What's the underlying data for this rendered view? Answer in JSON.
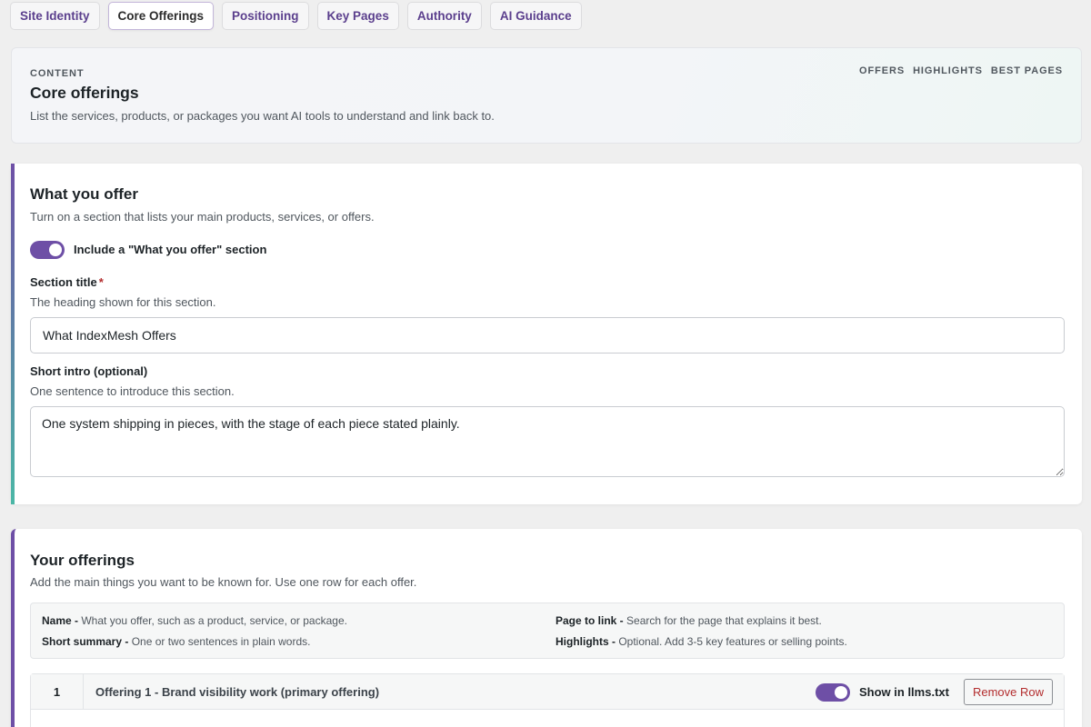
{
  "tabs": [
    {
      "label": "Site Identity",
      "active": false
    },
    {
      "label": "Core Offerings",
      "active": true
    },
    {
      "label": "Positioning",
      "active": false
    },
    {
      "label": "Key Pages",
      "active": false
    },
    {
      "label": "Authority",
      "active": false
    },
    {
      "label": "AI Guidance",
      "active": false
    }
  ],
  "header": {
    "eyebrow": "CONTENT",
    "title": "Core offerings",
    "description": "List the services, products, or packages you want AI tools to understand and link back to.",
    "quick_links": [
      "OFFERS",
      "HIGHLIGHTS",
      "BEST PAGES"
    ]
  },
  "what_you_offer": {
    "title": "What you offer",
    "description": "Turn on a section that lists your main products, services, or offers.",
    "toggle": {
      "label": "Include a \"What you offer\" section",
      "on": true
    },
    "section_title": {
      "label": "Section title",
      "required_mark": "*",
      "help": "The heading shown for this section.",
      "value": "What IndexMesh Offers"
    },
    "short_intro": {
      "label": "Short intro (optional)",
      "help": "One sentence to introduce this section.",
      "value": "One system shipping in pieces, with the stage of each piece stated plainly."
    }
  },
  "your_offerings": {
    "title": "Your offerings",
    "description": "Add the main things you want to be known for. Use one row for each offer.",
    "legend": [
      {
        "term": "Name -",
        "text": "What you offer, such as a product, service, or package."
      },
      {
        "term": "Short summary -",
        "text": "One or two sentences in plain words."
      },
      {
        "term": "Page to link -",
        "text": "Search for the page that explains it best."
      },
      {
        "term": "Highlights -",
        "text": "Optional. Add 3-5 key features or selling points."
      }
    ],
    "rows": [
      {
        "number": "1",
        "title": "Offering 1 - Brand visibility work (primary offering)",
        "show_toggle_label": "Show in llms.txt",
        "show_on": true,
        "remove_label": "Remove Row"
      }
    ]
  },
  "colors": {
    "accent": "#6e4fa6",
    "teal": "#4bb7a6",
    "danger": "#b32d2e"
  }
}
